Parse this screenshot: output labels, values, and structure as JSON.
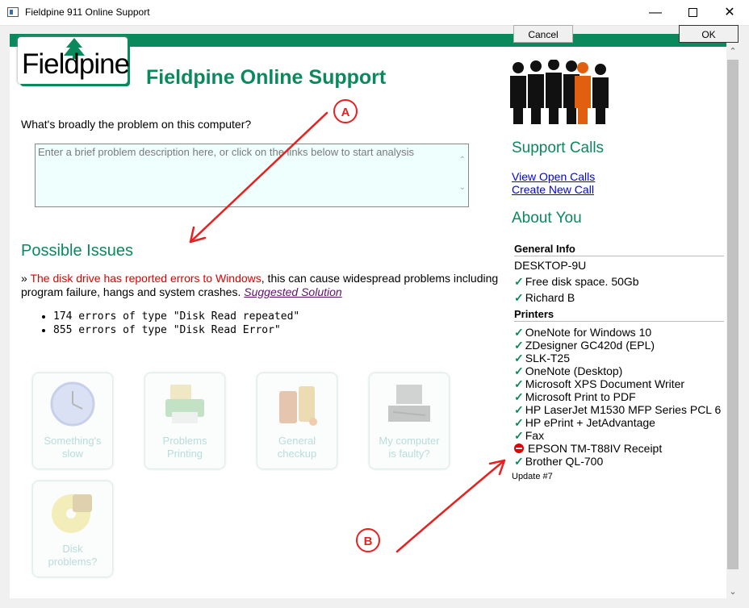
{
  "window": {
    "title": "Fieldpine 911 Online Support"
  },
  "buttons": {
    "cancel": "Cancel",
    "ok": "OK"
  },
  "logo": {
    "text": "Fieldpine"
  },
  "heading": "Fieldpine Online Support",
  "question": "What's broadly the problem on this computer?",
  "problem_input": {
    "value": "",
    "placeholder": "Enter a brief problem description here, or click on the links below to start analysis"
  },
  "issues": {
    "title": "Possible Issues",
    "prefix": "» ",
    "highlight": "The disk drive has reported errors to Windows",
    "rest": ", this can cause widespread problems including program failure, hangs and system crashes. ",
    "solution_link": "Suggested Solution",
    "bullets": [
      "174 errors of type \"Disk Read repeated\"",
      "855 errors of type \"Disk Read Error\""
    ]
  },
  "tiles": [
    {
      "line1": "Something's",
      "line2": "slow",
      "icon": "clock-icon"
    },
    {
      "line1": "Problems",
      "line2": "Printing",
      "icon": "printer-icon"
    },
    {
      "line1": "General",
      "line2": "checkup",
      "icon": "vitamins-icon"
    },
    {
      "line1": "My computer",
      "line2": "is faulty?",
      "icon": "broken-computer-icon"
    },
    {
      "line1": "Disk",
      "line2": "problems?",
      "icon": "disk-icon"
    }
  ],
  "support_calls": {
    "title": "Support Calls",
    "view_open": "View Open Calls",
    "create_new": "Create New Call"
  },
  "about_you": {
    "title": "About You",
    "general_info_heading": "General Info",
    "computer_name": "DESKTOP-9U",
    "general_items": [
      {
        "status": "ok",
        "text": "Free disk space. 50Gb"
      },
      {
        "status": "ok",
        "text": "Richard B"
      }
    ],
    "printers_heading": "Printers",
    "printers": [
      {
        "status": "ok",
        "text": "OneNote for Windows 10"
      },
      {
        "status": "ok",
        "text": "ZDesigner GC420d (EPL)"
      },
      {
        "status": "ok",
        "text": "SLK-T25"
      },
      {
        "status": "ok",
        "text": "OneNote (Desktop)"
      },
      {
        "status": "ok",
        "text": "Microsoft XPS Document Writer"
      },
      {
        "status": "ok",
        "text": "Microsoft Print to PDF"
      },
      {
        "status": "ok",
        "text": "HP LaserJet M1530 MFP Series PCL 6"
      },
      {
        "status": "ok",
        "text": "HP ePrint + JetAdvantage"
      },
      {
        "status": "ok",
        "text": "Fax"
      },
      {
        "status": "error",
        "text": "EPSON TM-T88IV Receipt"
      },
      {
        "status": "ok",
        "text": "Brother QL-700"
      }
    ],
    "update": "Update #7"
  },
  "annotations": {
    "a": "A",
    "b": "B"
  },
  "colors": {
    "brand_green": "#0a8a5c",
    "error_red": "#e00000",
    "annotation_red": "#e82020"
  }
}
